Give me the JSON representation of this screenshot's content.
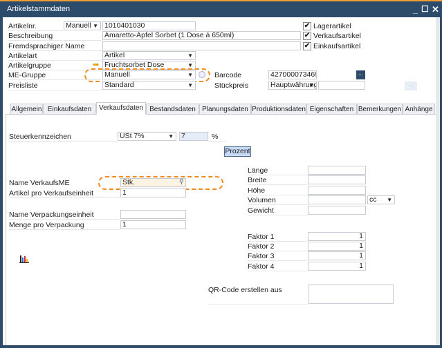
{
  "window": {
    "title": "Artikelstammdaten"
  },
  "header": {
    "artikelnr": {
      "label": "Artikelnr.",
      "mode": "Manuell",
      "value": "1010401030"
    },
    "beschreibung": {
      "label": "Beschreibung",
      "value": "Amaretto-Apfel Sorbet (1 Dose á 650ml)"
    },
    "fremdname": {
      "label": "Fremdsprachiger Name",
      "value": ""
    },
    "artikelart": {
      "label": "Artikelart",
      "value": "Artikel"
    },
    "artikelgruppe": {
      "label": "Artikelgruppe",
      "value": "Fruchtsorbet Dose"
    },
    "me_gruppe": {
      "label": "ME-Gruppe",
      "value": "Manuell"
    },
    "preisliste": {
      "label": "Preisliste",
      "value": "Standard"
    },
    "barcode": {
      "label": "Barcode",
      "value": "427000073469",
      "button": "..."
    },
    "stueckpreis": {
      "label": "Stückpreis",
      "currency": "Hauptwährung",
      "value": "",
      "button": "..."
    },
    "checkboxes": [
      {
        "label": "Lagerartikel",
        "checked": true
      },
      {
        "label": "Verkaufsartikel",
        "checked": true
      },
      {
        "label": "Einkaufsartikel",
        "checked": true
      }
    ]
  },
  "tabs": [
    "Allgemein",
    "Einkaufsdaten",
    "Verkaufsdaten",
    "Bestandsdaten",
    "Planungsdaten",
    "Produktionsdaten",
    "Eigenschaften",
    "Bemerkungen",
    "Anhänge"
  ],
  "active_tab": "Verkaufsdaten",
  "sales": {
    "steuer": {
      "label": "Steuerkennzeichen",
      "value": "USt 7%",
      "rate": "7",
      "unit": "%"
    },
    "prozent_button": "Prozent",
    "name_me": {
      "label": "Name VerkaufsME",
      "value": "Stk."
    },
    "artikel_pro_ve": {
      "label": "Artikel pro Verkaufseinheit",
      "value": "1"
    },
    "name_vpe": {
      "label": "Name Verpackungseinheit",
      "value": ""
    },
    "menge_vp": {
      "label": "Menge pro Verpackung",
      "value": "1"
    },
    "laenge": {
      "label": "Länge",
      "value": ""
    },
    "breite": {
      "label": "Breite",
      "value": ""
    },
    "hoehe": {
      "label": "Höhe",
      "value": ""
    },
    "volumen": {
      "label": "Volumen",
      "value": "",
      "unit": "cc"
    },
    "gewicht": {
      "label": "Gewicht",
      "value": ""
    },
    "faktoren": [
      {
        "label": "Faktor 1",
        "value": "1"
      },
      {
        "label": "Faktor 2",
        "value": "1"
      },
      {
        "label": "Faktor 3",
        "value": "1"
      },
      {
        "label": "Faktor 4",
        "value": "1"
      }
    ],
    "qr": {
      "label": "QR-Code erstellen aus",
      "value": ""
    }
  }
}
